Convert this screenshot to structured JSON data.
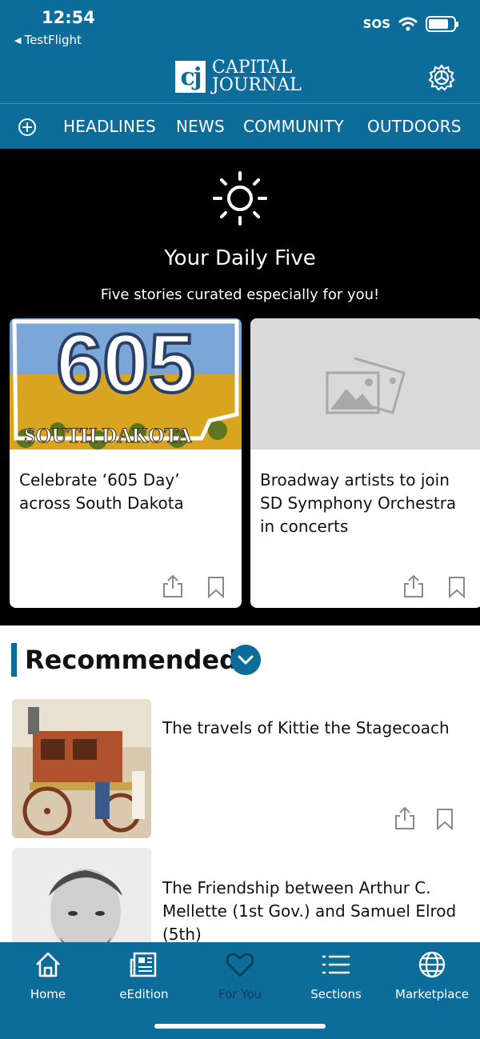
{
  "colors": {
    "brand": "#0c6d9b",
    "active_tab": "#0a3d56",
    "background_dark": "#000000"
  },
  "status_bar": {
    "time": "12:54",
    "back_label": "TestFlight",
    "carrier": "SOS"
  },
  "header": {
    "logo_mark": "cj",
    "logo_line1": "CAPITAL",
    "logo_line2": "JOURNAL",
    "settings_icon": "gear-icon"
  },
  "nav": {
    "add_icon": "plus-circle-icon",
    "tabs": [
      "HEADLINES",
      "NEWS",
      "COMMUNITY",
      "OUTDOORS"
    ]
  },
  "daily_five": {
    "icon": "sun-icon",
    "title": "Your Daily Five",
    "subtitle": "Five stories curated especially for you!",
    "cards": [
      {
        "image": "605-south-dakota-image",
        "title": "Celebrate ‘605 Day’ across South Dakota"
      },
      {
        "image": "placeholder-image-icon",
        "title": "Broadway artists to join SD Symphony Orchestra in concerts"
      }
    ]
  },
  "recommended": {
    "title": "Recommended",
    "toggle_icon": "chevron-down-icon",
    "items": [
      {
        "image": "stagecoach-photo",
        "title": "The travels of Kittie the Stagecoach"
      },
      {
        "image": "portrait-photo",
        "title": "The Friendship between Arthur C. Mellette (1st Gov.) and Samuel Elrod (5th)"
      }
    ]
  },
  "tab_bar": {
    "tabs": [
      {
        "label": "Home",
        "icon": "home-icon",
        "active": false
      },
      {
        "label": "eEdition",
        "icon": "newspaper-icon",
        "active": false
      },
      {
        "label": "For You",
        "icon": "heart-icon",
        "active": true
      },
      {
        "label": "Sections",
        "icon": "list-icon",
        "active": false
      },
      {
        "label": "Marketplace",
        "icon": "globe-icon",
        "active": false
      }
    ]
  }
}
